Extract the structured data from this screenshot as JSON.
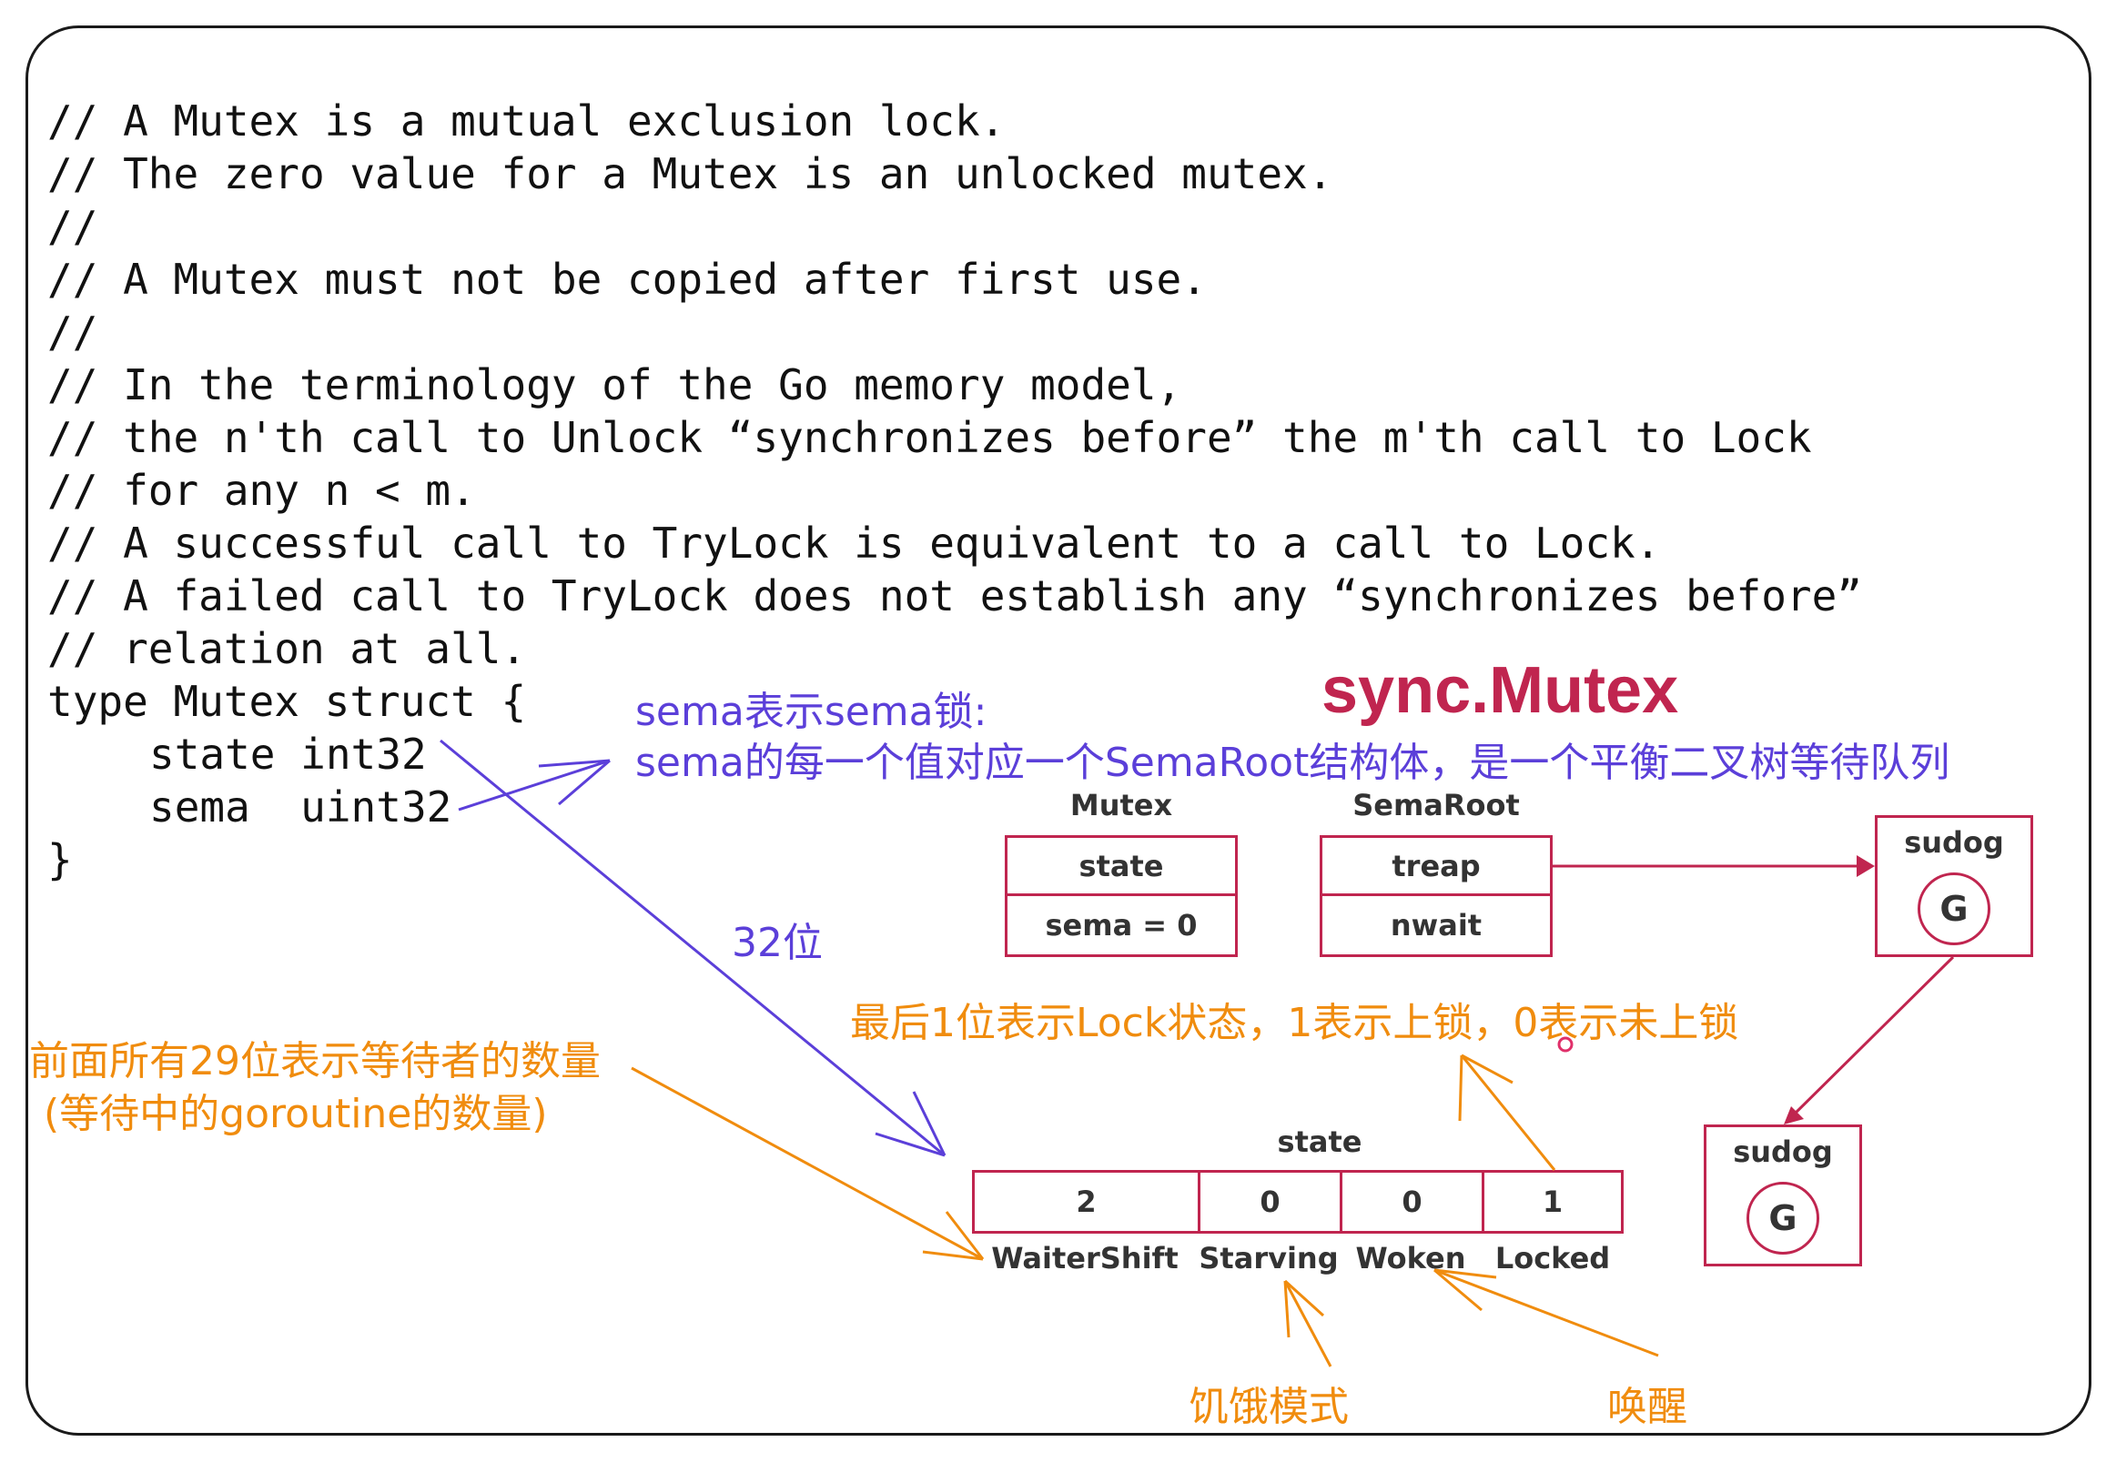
{
  "code": {
    "lines": [
      "// A Mutex is a mutual exclusion lock.",
      "// The zero value for a Mutex is an unlocked mutex.",
      "//",
      "// A Mutex must not be copied after first use.",
      "//",
      "// In the terminology of the Go memory model,",
      "// the n'th call to Unlock “synchronizes before” the m'th call to Lock",
      "// for any n < m.",
      "// A successful call to TryLock is equivalent to a call to Lock.",
      "// A failed call to TryLock does not establish any “synchronizes before”",
      "// relation at all.",
      "type Mutex struct {",
      "state int32",
      "sema  uint32",
      "}"
    ]
  },
  "title": "sync.Mutex",
  "annotations": {
    "sema_line1": "sema表示sema锁:",
    "sema_line2": "sema的每一个值对应一个SemaRoot结构体，是一个平衡二叉树等待队列",
    "bits32": "32位",
    "waiter_line1": "前面所有29位表示等待者的数量",
    "waiter_line2": "(等待中的goroutine的数量)",
    "lock_bit": "最后1位表示Lock状态，1表示上锁，0表示未上锁",
    "starving": "饥饿模式",
    "woken": "唤醒"
  },
  "mutex_box": {
    "label": "Mutex",
    "fields": [
      "state",
      "sema = 0"
    ]
  },
  "semaroot_box": {
    "label": "SemaRoot",
    "fields": [
      "treap",
      "nwait"
    ]
  },
  "sudog_nodes": [
    {
      "label": "sudog",
      "g": "G"
    },
    {
      "label": "sudog",
      "g": "G"
    }
  ],
  "state_bits": {
    "label": "state",
    "values": [
      "2",
      "0",
      "0",
      "1"
    ],
    "names": [
      "WaiterShift",
      "Starving",
      "Woken",
      "Locked"
    ]
  },
  "colors": {
    "purple": "#5b3fd9",
    "orange": "#f08c0e",
    "crimson": "#c0254f",
    "text": "#111111"
  }
}
